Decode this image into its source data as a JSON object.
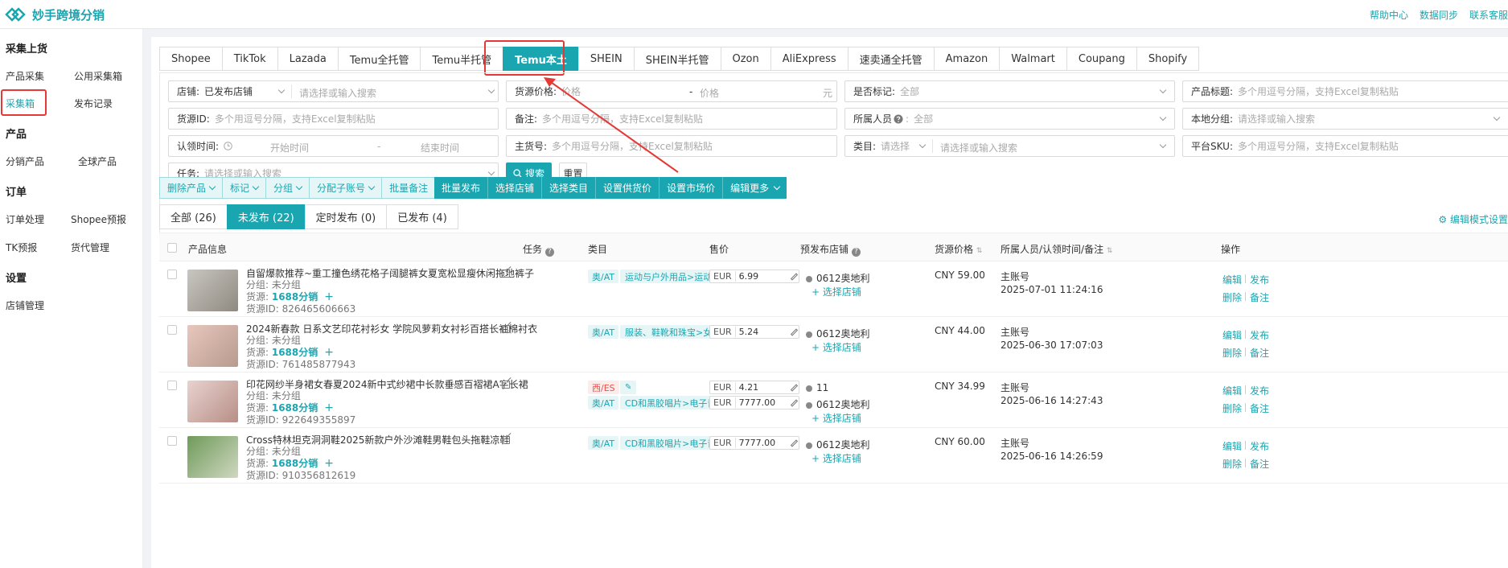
{
  "app": {
    "title": "妙手跨境分销"
  },
  "top_links": [
    "帮助中心",
    "数据同步",
    "联系客服"
  ],
  "sidebar": {
    "groups": [
      {
        "title": "采集上货",
        "items": [
          "产品采集",
          "公用采集箱",
          "采集箱",
          "发布记录"
        ]
      },
      {
        "title": "产品",
        "items": [
          "分销产品",
          "全球产品"
        ]
      },
      {
        "title": "订单",
        "items": [
          "订单处理",
          "Shopee预报",
          "TK预报",
          "货代管理"
        ]
      },
      {
        "title": "设置",
        "items": [
          "店铺管理"
        ]
      }
    ],
    "active": "采集箱"
  },
  "platform_tabs": [
    "Shopee",
    "TikTok",
    "Lazada",
    "Temu全托管",
    "Temu半托管",
    "Temu本土",
    "SHEIN",
    "SHEIN半托管",
    "Ozon",
    "AliExpress",
    "速卖通全托管",
    "Amazon",
    "Walmart",
    "Coupang",
    "Shopify"
  ],
  "active_platform": "Temu本土",
  "filters": {
    "store_label": "店铺:",
    "store_value": "已发布店铺",
    "store_search_ph": "请选择或输入搜索",
    "price_label": "货源价格:",
    "price_min_ph": "价格",
    "price_sep": "-",
    "price_max_ph": "价格",
    "price_unit": "元",
    "marked_label": "是否标记:",
    "marked_value": "全部",
    "title_label": "产品标题:",
    "title_ph": "多个用逗号分隔，支持Excel复制粘贴",
    "source_id_label": "货源ID:",
    "source_id_ph": "多个用逗号分隔，支持Excel复制粘贴",
    "remark_label": "备注:",
    "remark_ph": "多个用逗号分隔，支持Excel复制粘贴",
    "owner_label": "所属人员",
    "owner_value": "全部",
    "group_label": "本地分组:",
    "group_ph": "请选择或输入搜索",
    "claim_label": "认领时间:",
    "claim_start_ph": "开始时间",
    "claim_sep": "-",
    "claim_end_ph": "结束时间",
    "sku_label": "主货号:",
    "sku_ph": "多个用逗号分隔，支持Excel复制粘贴",
    "cat_label": "类目:",
    "cat_select": "请选择",
    "cat_ph": "请选择或输入搜索",
    "platform_sku_label": "平台SKU:",
    "platform_sku_ph": "多个用逗号分隔，支持Excel复制粘贴",
    "task_label": "任务:",
    "task_ph": "请选择或输入搜索",
    "search_btn": "搜索",
    "reset_btn": "重置"
  },
  "actions_light": [
    "删除产品",
    "标记",
    "分组",
    "分配子账号",
    "批量备注"
  ],
  "actions_dark": [
    "批量发布",
    "选择店铺",
    "选择类目",
    "设置供货价",
    "设置市场价",
    "编辑更多"
  ],
  "status_tabs": [
    "全部 (26)",
    "未发布 (22)",
    "定时发布 (0)",
    "已发布 (4)"
  ],
  "active_status": "未发布 (22)",
  "edit_mode": "编辑模式设置",
  "columns": [
    "产品信息",
    "任务",
    "类目",
    "售价",
    "预发布店铺",
    "货源价格",
    "所属人员/认领时间/备注",
    "操作"
  ],
  "labels": {
    "group": "分组:",
    "source": "货源:",
    "source_id": "货源ID:",
    "select_store": "+ 选择店铺",
    "plus": "+",
    "edit": "编辑",
    "publish": "发布",
    "delete": "删除",
    "remark": "备注"
  },
  "rows": [
    {
      "title": "自留爆款推荐~重工撞色绣花格子阔腿裤女夏宽松显瘦休闲拖地裤子",
      "group": "未分组",
      "source": "1688分销",
      "source_id": "826465606663",
      "cats": [
        {
          "badge": "奥/AT",
          "kind": "at",
          "path": "运动与户外用品>运动与户外..."
        }
      ],
      "prices": [
        {
          "cur": "EUR",
          "val": "6.99"
        }
      ],
      "stores": [
        "0612奥地利"
      ],
      "src_price": "CNY 59.00",
      "owner": "主账号",
      "time": "2025-07-01 11:24:16",
      "thumb": [
        "#c9c6c1",
        "#8f8a80"
      ]
    },
    {
      "title": "2024新春款 日系文艺印花衬衫女 学院风萝莉女衬衫百搭长袖棉衬衣",
      "group": "未分组",
      "source": "1688分销",
      "source_id": "761485877943",
      "cats": [
        {
          "badge": "奥/AT",
          "kind": "at",
          "path": "服装、鞋靴和珠宝>女装..."
        }
      ],
      "prices": [
        {
          "cur": "EUR",
          "val": "5.24"
        }
      ],
      "stores": [
        "0612奥地利"
      ],
      "src_price": "CNY 44.00",
      "owner": "主账号",
      "time": "2025-06-30 17:07:03",
      "thumb": [
        "#e8c7bd",
        "#b89a8f"
      ]
    },
    {
      "title": "印花网纱半身裙女春夏2024新中式纱裙中长款垂感百褶裙A字长裙",
      "group": "未分组",
      "source": "1688分销",
      "source_id": "922649355897",
      "cats": [
        {
          "badge": "西/ES",
          "kind": "es",
          "path": ""
        },
        {
          "badge": "奥/AT",
          "kind": "at",
          "path": "CD和黑胶唱片>电子音乐..."
        }
      ],
      "prices": [
        {
          "cur": "EUR",
          "val": "4.21"
        },
        {
          "cur": "EUR",
          "val": "7777.00"
        }
      ],
      "stores": [
        "11",
        "0612奥地利"
      ],
      "src_price": "CNY 34.99",
      "owner": "主账号",
      "time": "2025-06-16 14:27:43",
      "thumb": [
        "#e9d2cf",
        "#b78f86"
      ]
    },
    {
      "title": "Cross特林坦克洞洞鞋2025新款户外沙滩鞋男鞋包头拖鞋凉鞋",
      "group": "未分组",
      "source": "1688分销",
      "source_id": "910356812619",
      "cats": [
        {
          "badge": "奥/AT",
          "kind": "at",
          "path": "CD和黑胶唱片>电子音乐..."
        }
      ],
      "prices": [
        {
          "cur": "EUR",
          "val": "7777.00"
        }
      ],
      "stores": [
        "0612奥地利"
      ],
      "src_price": "CNY 60.00",
      "owner": "主账号",
      "time": "2025-06-16 14:26:59",
      "thumb": [
        "#6f9a5a",
        "#cfd8c0"
      ]
    }
  ],
  "colors": {
    "accent": "#1aa6b0",
    "highlight": "#e53935"
  }
}
